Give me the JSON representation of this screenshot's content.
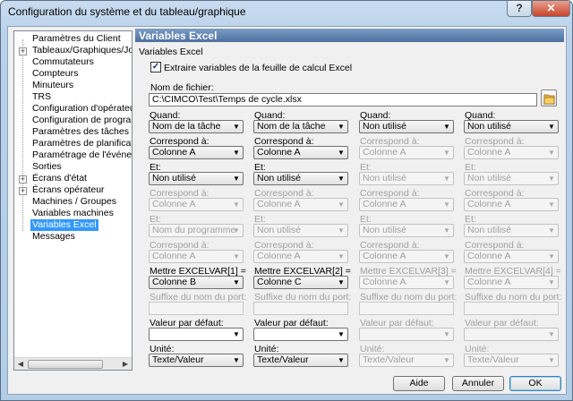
{
  "window": {
    "title": "Configuration du système et du tableau/graphique",
    "help": "?",
    "close": "✕"
  },
  "tree": {
    "items": [
      {
        "label": "Paramètres du Client",
        "expander": ""
      },
      {
        "label": "Tableaux/Graphiques/Journaux",
        "expander": "+"
      },
      {
        "label": "Commutateurs",
        "expander": ""
      },
      {
        "label": "Compteurs",
        "expander": ""
      },
      {
        "label": "Minuteurs",
        "expander": ""
      },
      {
        "label": "TRS",
        "expander": ""
      },
      {
        "label": "Configuration d'opérateur",
        "expander": ""
      },
      {
        "label": "Configuration de programme",
        "expander": ""
      },
      {
        "label": "Paramètres des tâches",
        "expander": ""
      },
      {
        "label": "Paramètres de planification",
        "expander": ""
      },
      {
        "label": "Paramétrage de l'événement",
        "expander": ""
      },
      {
        "label": "Sorties",
        "expander": ""
      },
      {
        "label": "Écrans d'état",
        "expander": "+"
      },
      {
        "label": "Écrans opérateur",
        "expander": "+"
      },
      {
        "label": "Machines / Groupes",
        "expander": ""
      },
      {
        "label": "Variables machines",
        "expander": ""
      },
      {
        "label": "Variables Excel",
        "expander": "",
        "selected": true
      },
      {
        "label": "Messages",
        "expander": ""
      }
    ]
  },
  "panel": {
    "header": "Variables Excel",
    "group_label": "Variables Excel",
    "extract_checkbox_label": "Extraire variables de la feuille de calcul Excel",
    "extract_checked": "✓",
    "filename_label": "Nom de fichier:",
    "filename_value": "C:\\CIMCO\\Test\\Temps de cycle.xlsx",
    "dropdown_glyph": "▼",
    "columns": [
      {
        "quand_label": "Quand:",
        "quand": "Nom de la tâche",
        "correspond1_label": "Correspond à:",
        "correspond1": "Colonne A",
        "et1_label": "Et:",
        "et1": "Non utilisé",
        "correspond2_label": "Correspond à:",
        "correspond2": "Colonne A",
        "et2_label": "Et:",
        "et2": "Nom du programme",
        "correspond3_label": "Correspond à:",
        "correspond3": "Colonne A",
        "mettre_label": "Mettre EXCELVAR[1] =",
        "mettre": "Colonne B",
        "suffixe_label": "Suffixe du nom du port:",
        "defaut_label": "Valeur par défaut:",
        "unite_label": "Unité:",
        "unite": "Texte/Valeur"
      },
      {
        "quand_label": "Quand:",
        "quand": "Nom de la tâche",
        "correspond1_label": "Correspond à:",
        "correspond1": "Colonne A",
        "et1_label": "Et:",
        "et1": "Non utilisé",
        "correspond2_label": "Correspond à:",
        "correspond2": "Colonne A",
        "et2_label": "Et:",
        "et2": "Non utilisé",
        "correspond3_label": "Correspond à:",
        "correspond3": "Colonne A",
        "mettre_label": "Mettre EXCELVAR[2] =",
        "mettre": "Colonne C",
        "suffixe_label": "Suffixe du nom du port:",
        "defaut_label": "Valeur par défaut:",
        "unite_label": "Unité:",
        "unite": "Texte/Valeur"
      },
      {
        "quand_label": "Quand:",
        "quand": "Non utilisé",
        "correspond1_label": "Correspond à:",
        "correspond1": "Colonne A",
        "et1_label": "Et:",
        "et1": "Non utilisé",
        "correspond2_label": "Correspond à:",
        "correspond2": "Colonne A",
        "et2_label": "Et:",
        "et2": "Non utilisé",
        "correspond3_label": "Correspond à:",
        "correspond3": "Colonne A",
        "mettre_label": "Mettre EXCELVAR[3] =",
        "mettre": "Colonne A",
        "suffixe_label": "Suffixe du nom du port:",
        "defaut_label": "Valeur par défaut:",
        "unite_label": "Unité:",
        "unite": "Texte/Valeur"
      },
      {
        "quand_label": "Quand:",
        "quand": "Non utilisé",
        "correspond1_label": "Correspond à:",
        "correspond1": "Colonne A",
        "et1_label": "Et:",
        "et1": "Non utilisé",
        "correspond2_label": "Correspond à:",
        "correspond2": "Colonne A",
        "et2_label": "Et:",
        "et2": "Non utilisé",
        "correspond3_label": "Correspond à:",
        "correspond3": "Colonne A",
        "mettre_label": "Mettre EXCELVAR[4] =",
        "mettre": "Colonne A",
        "suffixe_label": "Suffixe du nom du port:",
        "defaut_label": "Valeur par défaut:",
        "unite_label": "Unité:",
        "unite": "Texte/Valeur"
      }
    ]
  },
  "buttons": {
    "aide": "Aide",
    "annuler": "Annuler",
    "ok": "OK"
  }
}
